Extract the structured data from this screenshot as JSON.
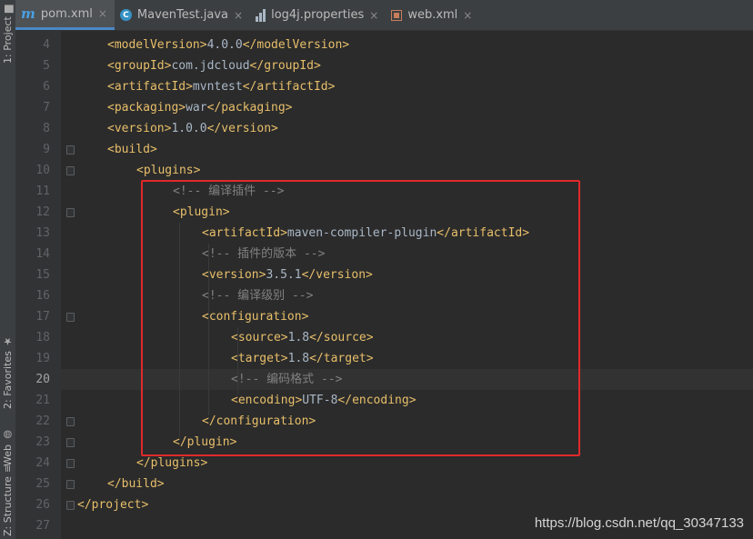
{
  "side_tabs": [
    {
      "label": "1: Project",
      "icon": "folder-icon"
    },
    {
      "label": "2: Favorites",
      "icon": "star-icon"
    },
    {
      "label": "Web",
      "icon": "globe-icon"
    },
    {
      "label": "Z: Structure",
      "icon": "structure-icon"
    }
  ],
  "tabs": [
    {
      "label": "pom.xml",
      "icon": "maven-icon",
      "active": true
    },
    {
      "label": "MavenTest.java",
      "icon": "java-class-icon",
      "active": false
    },
    {
      "label": "log4j.properties",
      "icon": "properties-icon",
      "active": false
    },
    {
      "label": "web.xml",
      "icon": "web-xml-icon",
      "active": false
    }
  ],
  "close_glyph": "×",
  "current_line": 20,
  "lines": [
    {
      "num": "4",
      "indent": 1,
      "parts": [
        [
          "t",
          "<modelVersion>"
        ],
        [
          "v",
          "4.0.0"
        ],
        [
          "t",
          "</modelVersion>"
        ]
      ]
    },
    {
      "num": "5",
      "indent": 1,
      "parts": [
        [
          "t",
          "<groupId>"
        ],
        [
          "v",
          "com.jdcloud"
        ],
        [
          "t",
          "</groupId>"
        ]
      ]
    },
    {
      "num": "6",
      "indent": 1,
      "parts": [
        [
          "t",
          "<artifactId>"
        ],
        [
          "v",
          "mvntest"
        ],
        [
          "t",
          "</artifactId>"
        ]
      ]
    },
    {
      "num": "7",
      "indent": 1,
      "parts": [
        [
          "t",
          "<packaging>"
        ],
        [
          "v",
          "war"
        ],
        [
          "t",
          "</packaging>"
        ]
      ]
    },
    {
      "num": "8",
      "indent": 1,
      "parts": [
        [
          "t",
          "<version>"
        ],
        [
          "v",
          "1.0.0"
        ],
        [
          "t",
          "</version>"
        ]
      ]
    },
    {
      "num": "9",
      "indent": 1,
      "parts": [
        [
          "t",
          "<build>"
        ]
      ]
    },
    {
      "num": "10",
      "indent": 2,
      "parts": [
        [
          "t",
          "<plugins>"
        ]
      ]
    },
    {
      "num": "11",
      "indent": 3,
      "parts": [
        [
          "c",
          "<!-- 编译插件 -->"
        ]
      ]
    },
    {
      "num": "12",
      "indent": 3,
      "parts": [
        [
          "t",
          "<plugin>"
        ]
      ]
    },
    {
      "num": "13",
      "indent": 4,
      "parts": [
        [
          "t",
          "<artifactId>"
        ],
        [
          "v",
          "maven-compiler-plugin"
        ],
        [
          "t",
          "</artifactId>"
        ]
      ]
    },
    {
      "num": "14",
      "indent": 4,
      "parts": [
        [
          "c",
          "<!-- 插件的版本 -->"
        ]
      ]
    },
    {
      "num": "15",
      "indent": 4,
      "parts": [
        [
          "t",
          "<version>"
        ],
        [
          "v",
          "3.5.1"
        ],
        [
          "t",
          "</version>"
        ]
      ]
    },
    {
      "num": "16",
      "indent": 4,
      "parts": [
        [
          "c",
          "<!-- 编译级别 -->"
        ]
      ]
    },
    {
      "num": "17",
      "indent": 4,
      "parts": [
        [
          "t",
          "<configuration>"
        ]
      ]
    },
    {
      "num": "18",
      "indent": 5,
      "parts": [
        [
          "t",
          "<source>"
        ],
        [
          "v",
          "1.8"
        ],
        [
          "t",
          "</source>"
        ]
      ]
    },
    {
      "num": "19",
      "indent": 5,
      "parts": [
        [
          "t",
          "<target>"
        ],
        [
          "v",
          "1.8"
        ],
        [
          "t",
          "</target>"
        ]
      ]
    },
    {
      "num": "20",
      "indent": 5,
      "parts": [
        [
          "c",
          "<!-- 编码格式 -->"
        ]
      ]
    },
    {
      "num": "21",
      "indent": 5,
      "parts": [
        [
          "t",
          "<encoding>"
        ],
        [
          "v",
          "UTF-8"
        ],
        [
          "t",
          "</encoding>"
        ]
      ]
    },
    {
      "num": "22",
      "indent": 4,
      "parts": [
        [
          "t",
          "</configuration>"
        ]
      ]
    },
    {
      "num": "23",
      "indent": 3,
      "parts": [
        [
          "t",
          "</plugin>"
        ]
      ]
    },
    {
      "num": "24",
      "indent": 2,
      "parts": [
        [
          "t",
          "</plugins>"
        ]
      ]
    },
    {
      "num": "25",
      "indent": 1,
      "parts": [
        [
          "t",
          "</build>"
        ]
      ]
    },
    {
      "num": "26",
      "indent": 0,
      "parts": [
        [
          "t",
          "</project>"
        ]
      ]
    },
    {
      "num": "27",
      "indent": 0,
      "parts": []
    }
  ],
  "watermark": "https://blog.csdn.net/qq_30347133",
  "colors": {
    "tag": "#e8bf6a",
    "text": "#a9b7c6",
    "comment": "#808080",
    "highlight_box": "#e0292b",
    "active_tab_underline": "#4a88c7"
  }
}
